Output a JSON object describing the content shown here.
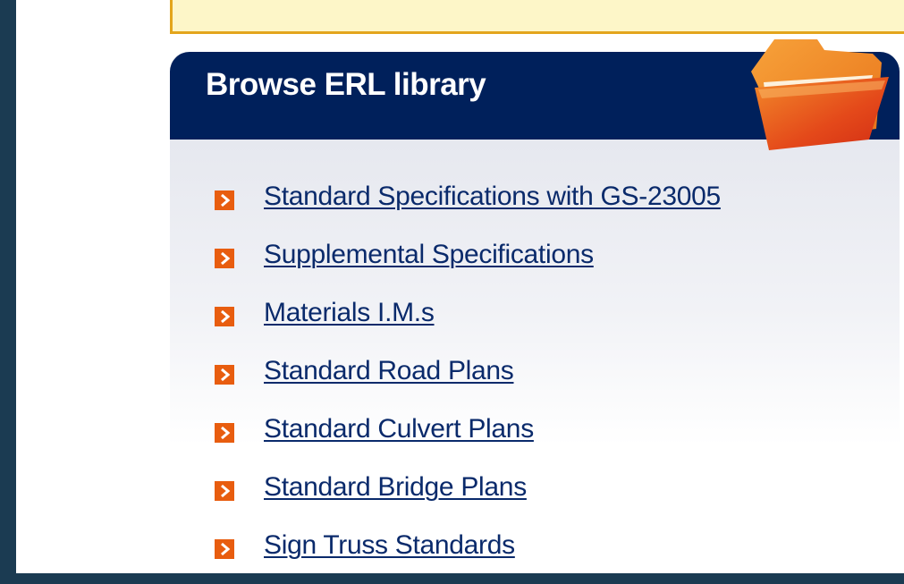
{
  "panel": {
    "title": "Browse ERL library"
  },
  "links": [
    {
      "label": "Standard Specifications with GS-23005"
    },
    {
      "label": "Supplemental Specifications"
    },
    {
      "label": "Materials I.M.s"
    },
    {
      "label": "Standard Road Plans"
    },
    {
      "label": "Standard Culvert Plans"
    },
    {
      "label": "Standard Bridge Plans"
    },
    {
      "label": "Sign Truss Standards"
    }
  ],
  "icons": {
    "panel_icon": "folder-icon",
    "bullet_icon": "arrow-right-icon"
  },
  "colors": {
    "header_bg": "#00205b",
    "link_color": "#0a2a6b",
    "bullet_color": "#e85d0f",
    "notice_border": "#e3a51c",
    "notice_bg": "#fdf6c8",
    "outer_bg": "#1b3b52"
  }
}
